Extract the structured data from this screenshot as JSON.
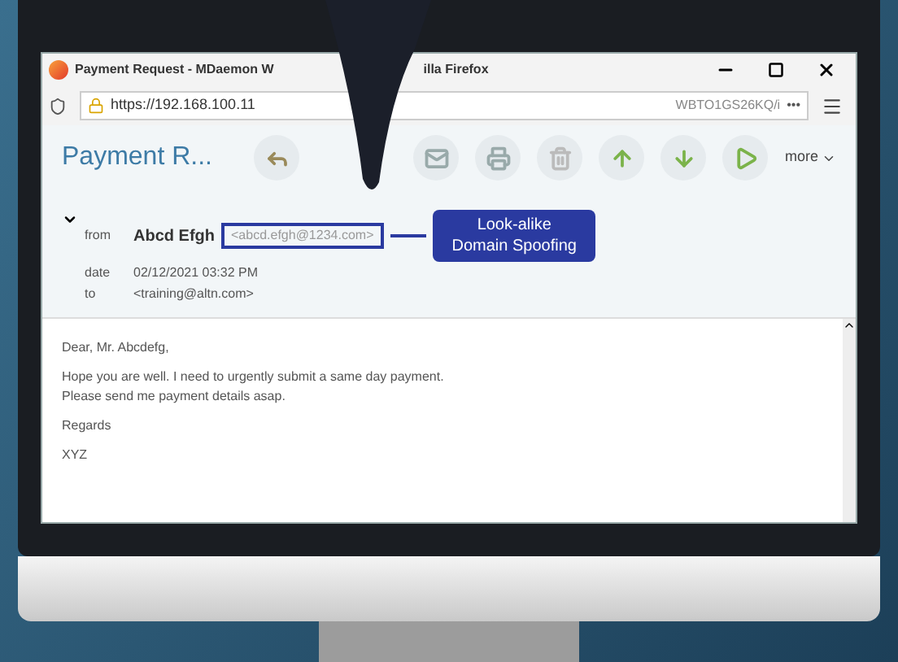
{
  "window": {
    "title_start": "Payment Request - MDaemon W",
    "title_end": "illa Firefox"
  },
  "address_bar": {
    "url_start": "https://192.168.100.11",
    "url_end": "WBTO1GS26KQ/i",
    "more": "•••"
  },
  "message": {
    "subject": "Payment R...",
    "more": "more",
    "expanded": true,
    "headers": [
      {
        "label": "from",
        "name": "Abcd Efgh",
        "value": "<abcd.efgh@1234.com>",
        "flagged": true
      },
      {
        "label": "date",
        "value": "02/12/2021 03:32 PM",
        "flagged": false
      },
      {
        "label": "to",
        "value": "<training@altn.com>",
        "flagged": false
      }
    ]
  },
  "callout": {
    "lines": [
      "Look-alike",
      "Domain Spoofing"
    ]
  },
  "body": [
    [
      "Dear, Mr. Abcdefg,"
    ],
    [
      "Hope you are well. I need to urgently submit a same day payment.",
      "Please send me payment details asap."
    ],
    [
      "Regards"
    ],
    [
      "XYZ"
    ]
  ]
}
